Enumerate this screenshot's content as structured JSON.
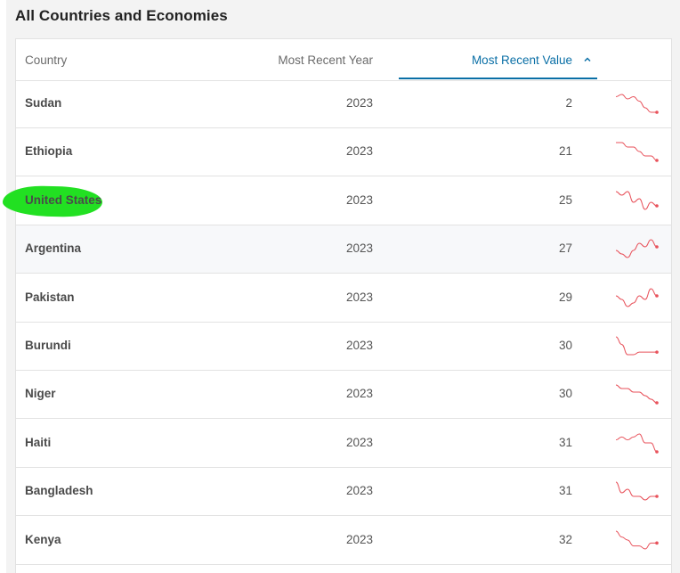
{
  "section": {
    "title": "All Countries and Economies"
  },
  "table": {
    "columns": {
      "country": "Country",
      "year": "Most Recent Year",
      "value": "Most Recent Value"
    },
    "sort": {
      "column": "value",
      "direction": "ascending"
    },
    "sparkline_color": "#e8525b",
    "highlight_color": "#22e022",
    "rows": [
      {
        "country": "Sudan",
        "year": "2023",
        "value": "2",
        "trend": [
          9,
          10,
          8,
          9,
          7,
          4,
          2,
          2
        ]
      },
      {
        "country": "Ethiopia",
        "year": "2023",
        "value": "21",
        "trend": [
          9,
          9,
          8,
          8,
          7,
          6,
          6,
          5
        ]
      },
      {
        "country": "United States",
        "year": "2023",
        "value": "25",
        "trend": [
          9,
          8,
          9,
          6,
          7,
          4,
          6,
          5
        ]
      },
      {
        "country": "Argentina",
        "year": "2023",
        "value": "27",
        "trend": [
          6,
          5,
          4,
          6,
          8,
          7,
          9,
          7
        ]
      },
      {
        "country": "Pakistan",
        "year": "2023",
        "value": "29",
        "trend": [
          6,
          5,
          3,
          4,
          6,
          5,
          8,
          6
        ]
      },
      {
        "country": "Burundi",
        "year": "2023",
        "value": "30",
        "trend": [
          10,
          7,
          3,
          3,
          4,
          4,
          4,
          4
        ]
      },
      {
        "country": "Niger",
        "year": "2023",
        "value": "30",
        "trend": [
          9,
          8,
          8,
          7,
          7,
          6,
          5,
          4
        ]
      },
      {
        "country": "Haiti",
        "year": "2023",
        "value": "31",
        "trend": [
          7,
          8,
          7,
          8,
          9,
          6,
          6,
          3
        ]
      },
      {
        "country": "Bangladesh",
        "year": "2023",
        "value": "31",
        "trend": [
          9,
          6,
          7,
          5,
          5,
          4,
          5,
          5
        ]
      },
      {
        "country": "Kenya",
        "year": "2023",
        "value": "32",
        "trend": [
          9,
          7,
          6,
          4,
          4,
          3,
          5,
          5
        ]
      }
    ]
  }
}
